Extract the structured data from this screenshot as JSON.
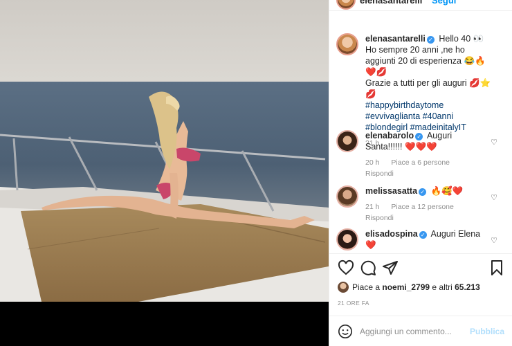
{
  "post": {
    "photo_alt": "",
    "header": {
      "username": "elenasantarelli",
      "follow_label": "Segui",
      "more_label": "•••"
    },
    "caption": {
      "username": "elenasantarelli",
      "line1": "Hello 40 👀",
      "line2": "Ho sempre 20 anni ,ne ho aggiunti 20 di esperienza 😂🔥❤️💋",
      "line3": "Grazie a tutti per gli auguri 💋⭐💋",
      "hashtags": "#happybirthdaytome #evvivaglianta #40anni #blondegirl #madeinitalyIT",
      "time": "21 h"
    },
    "comments": [
      {
        "username": "elenabarolo",
        "text": "Auguri Santa!!!!!! ❤️❤️❤️",
        "time": "20 h",
        "likes": "Piace a 6 persone",
        "reply": "Rispondi"
      },
      {
        "username": "melissasatta",
        "text": "🔥🥰❤️",
        "time": "21 h",
        "likes": "Piace a 12 persone",
        "reply": "Rispondi"
      },
      {
        "username": "elisadospina",
        "text": "Auguri Elena ❤️"
      }
    ],
    "likes_prefix": "Piace a ",
    "likes_user": "noemi_2799",
    "likes_mid": " e altri ",
    "likes_count": "65.213",
    "timestamp": "21 ORE FA",
    "add_comment_placeholder": "Aggiungi un commento...",
    "publish_label": "Pubblica"
  }
}
